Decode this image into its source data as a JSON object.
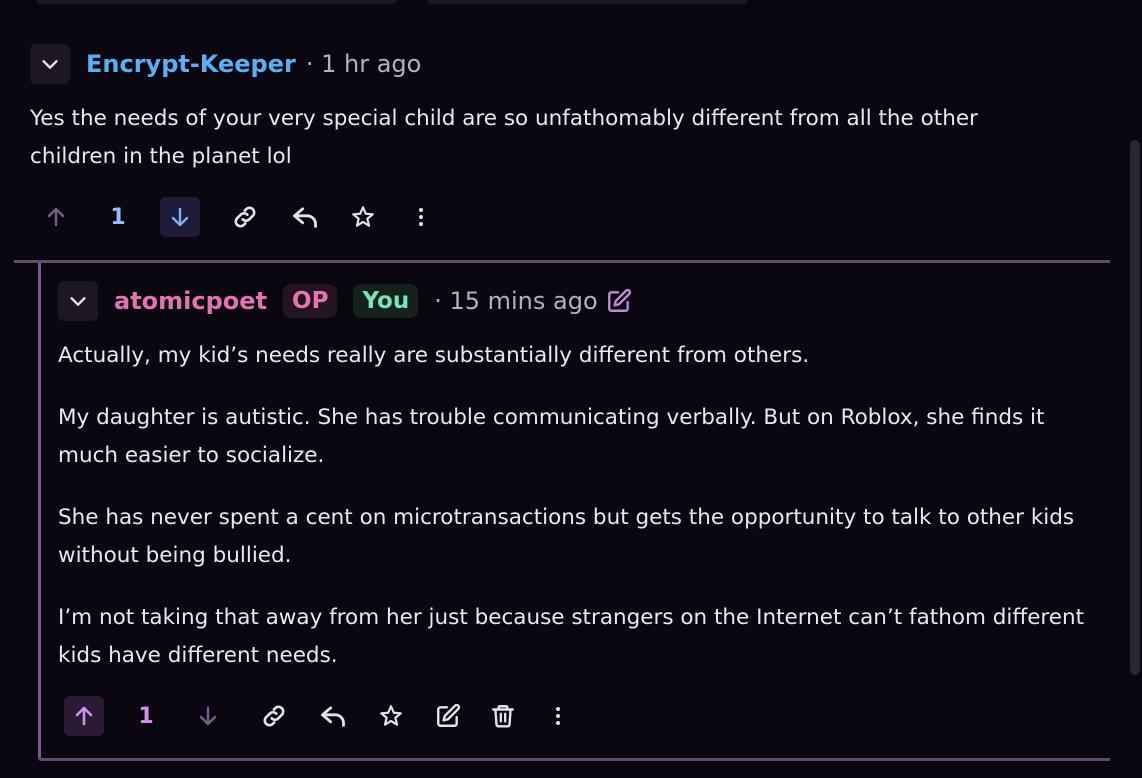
{
  "colors": {
    "background": "#0b0710",
    "username_primary": "#5aaef2",
    "username_op": "#e373b0",
    "upvote_active": "#d68df0",
    "count_primary": "#8fbfff",
    "downvote_active": "#7ab2f2"
  },
  "comment1": {
    "username": "Encrypt-Keeper",
    "time": "· 1 hr ago",
    "body": "Yes the needs of your very special child are so unfathomably different from all the other children in the planet lol",
    "score": "1",
    "vote_state": "downvoted",
    "icons": [
      "chevron-down-icon",
      "arrow-up-icon",
      "arrow-down-icon",
      "link-icon",
      "reply-icon",
      "star-icon",
      "more-vertical-icon"
    ]
  },
  "comment2": {
    "username": "atomicpoet",
    "badge_op": "OP",
    "badge_you": "You",
    "time": "· 15 mins ago",
    "paragraphs": [
      "Actually, my kid’s needs really are substantially different from others.",
      "My daughter is autistic. She has trouble communicating verbally. But on Roblox, she finds it much easier to socialize.",
      "She has never spent a cent on microtransactions but gets the opportunity to talk to other kids without being bullied.",
      "I’m not taking that away from her just because strangers on the Internet can’t fathom different kids have different needs."
    ],
    "score": "1",
    "vote_state": "upvoted",
    "icons": [
      "chevron-down-icon",
      "edited-icon",
      "arrow-up-icon",
      "arrow-down-icon",
      "link-icon",
      "reply-icon",
      "star-icon",
      "edit-icon",
      "trash-icon",
      "more-vertical-icon"
    ]
  }
}
